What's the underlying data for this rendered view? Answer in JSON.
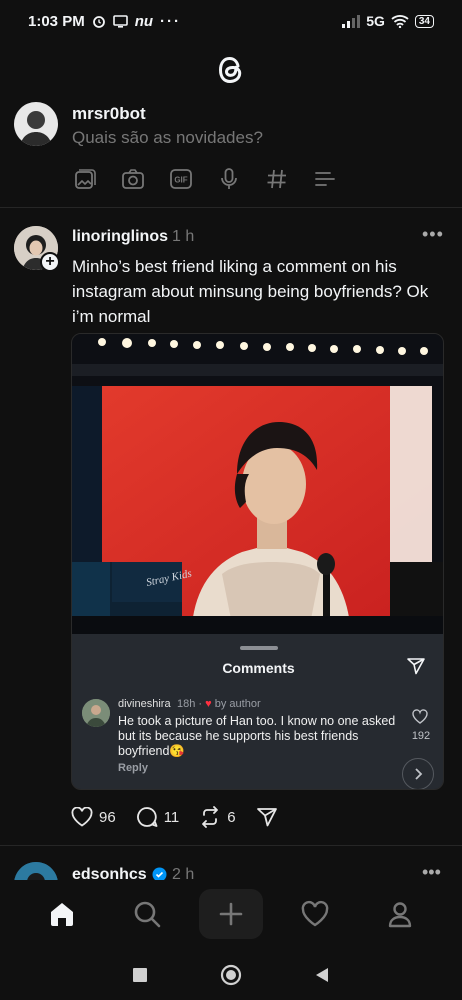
{
  "status_bar": {
    "time": "1:03 PM",
    "notif_text": "nu",
    "network": "5G",
    "battery": "34"
  },
  "app": {
    "logo": "threads-logo-icon"
  },
  "composer": {
    "username": "mrsr0bot",
    "placeholder": "Quais são as novidades?",
    "tools": [
      "gallery-icon",
      "camera-icon",
      "gif-icon",
      "mic-icon",
      "hashtag-icon",
      "poll-icon"
    ]
  },
  "post": {
    "username": "linoringlinos",
    "time": "1 h",
    "more": "•••",
    "text": "Minho’s best friend liking a comment on his instagram about minsung being boyfriends? Ok i’m normal",
    "image_sign_text": "Stray Kids",
    "embedded_comments": {
      "title": "Comments",
      "comment": {
        "username": "divineshira",
        "time": "18h",
        "by_author": "by author",
        "text": "He took a picture of Han too. I know no one asked but its because he supports his best friends boyfriend😘",
        "likes": "192",
        "reply_label": "Reply"
      }
    },
    "actions": {
      "likes": "96",
      "replies": "11",
      "reposts": "6"
    }
  },
  "next_post": {
    "username": "edsonhcs",
    "time": "2 h",
    "more": "•••"
  },
  "tabbar": [
    "home-icon",
    "search-icon",
    "create-icon",
    "activity-icon",
    "profile-icon"
  ],
  "colors": {
    "background": "#101010",
    "text": "#f3f5f7",
    "muted": "#777777",
    "comment_panel": "#262a30",
    "heart": "#ff3040",
    "verified": "#0095f6"
  }
}
